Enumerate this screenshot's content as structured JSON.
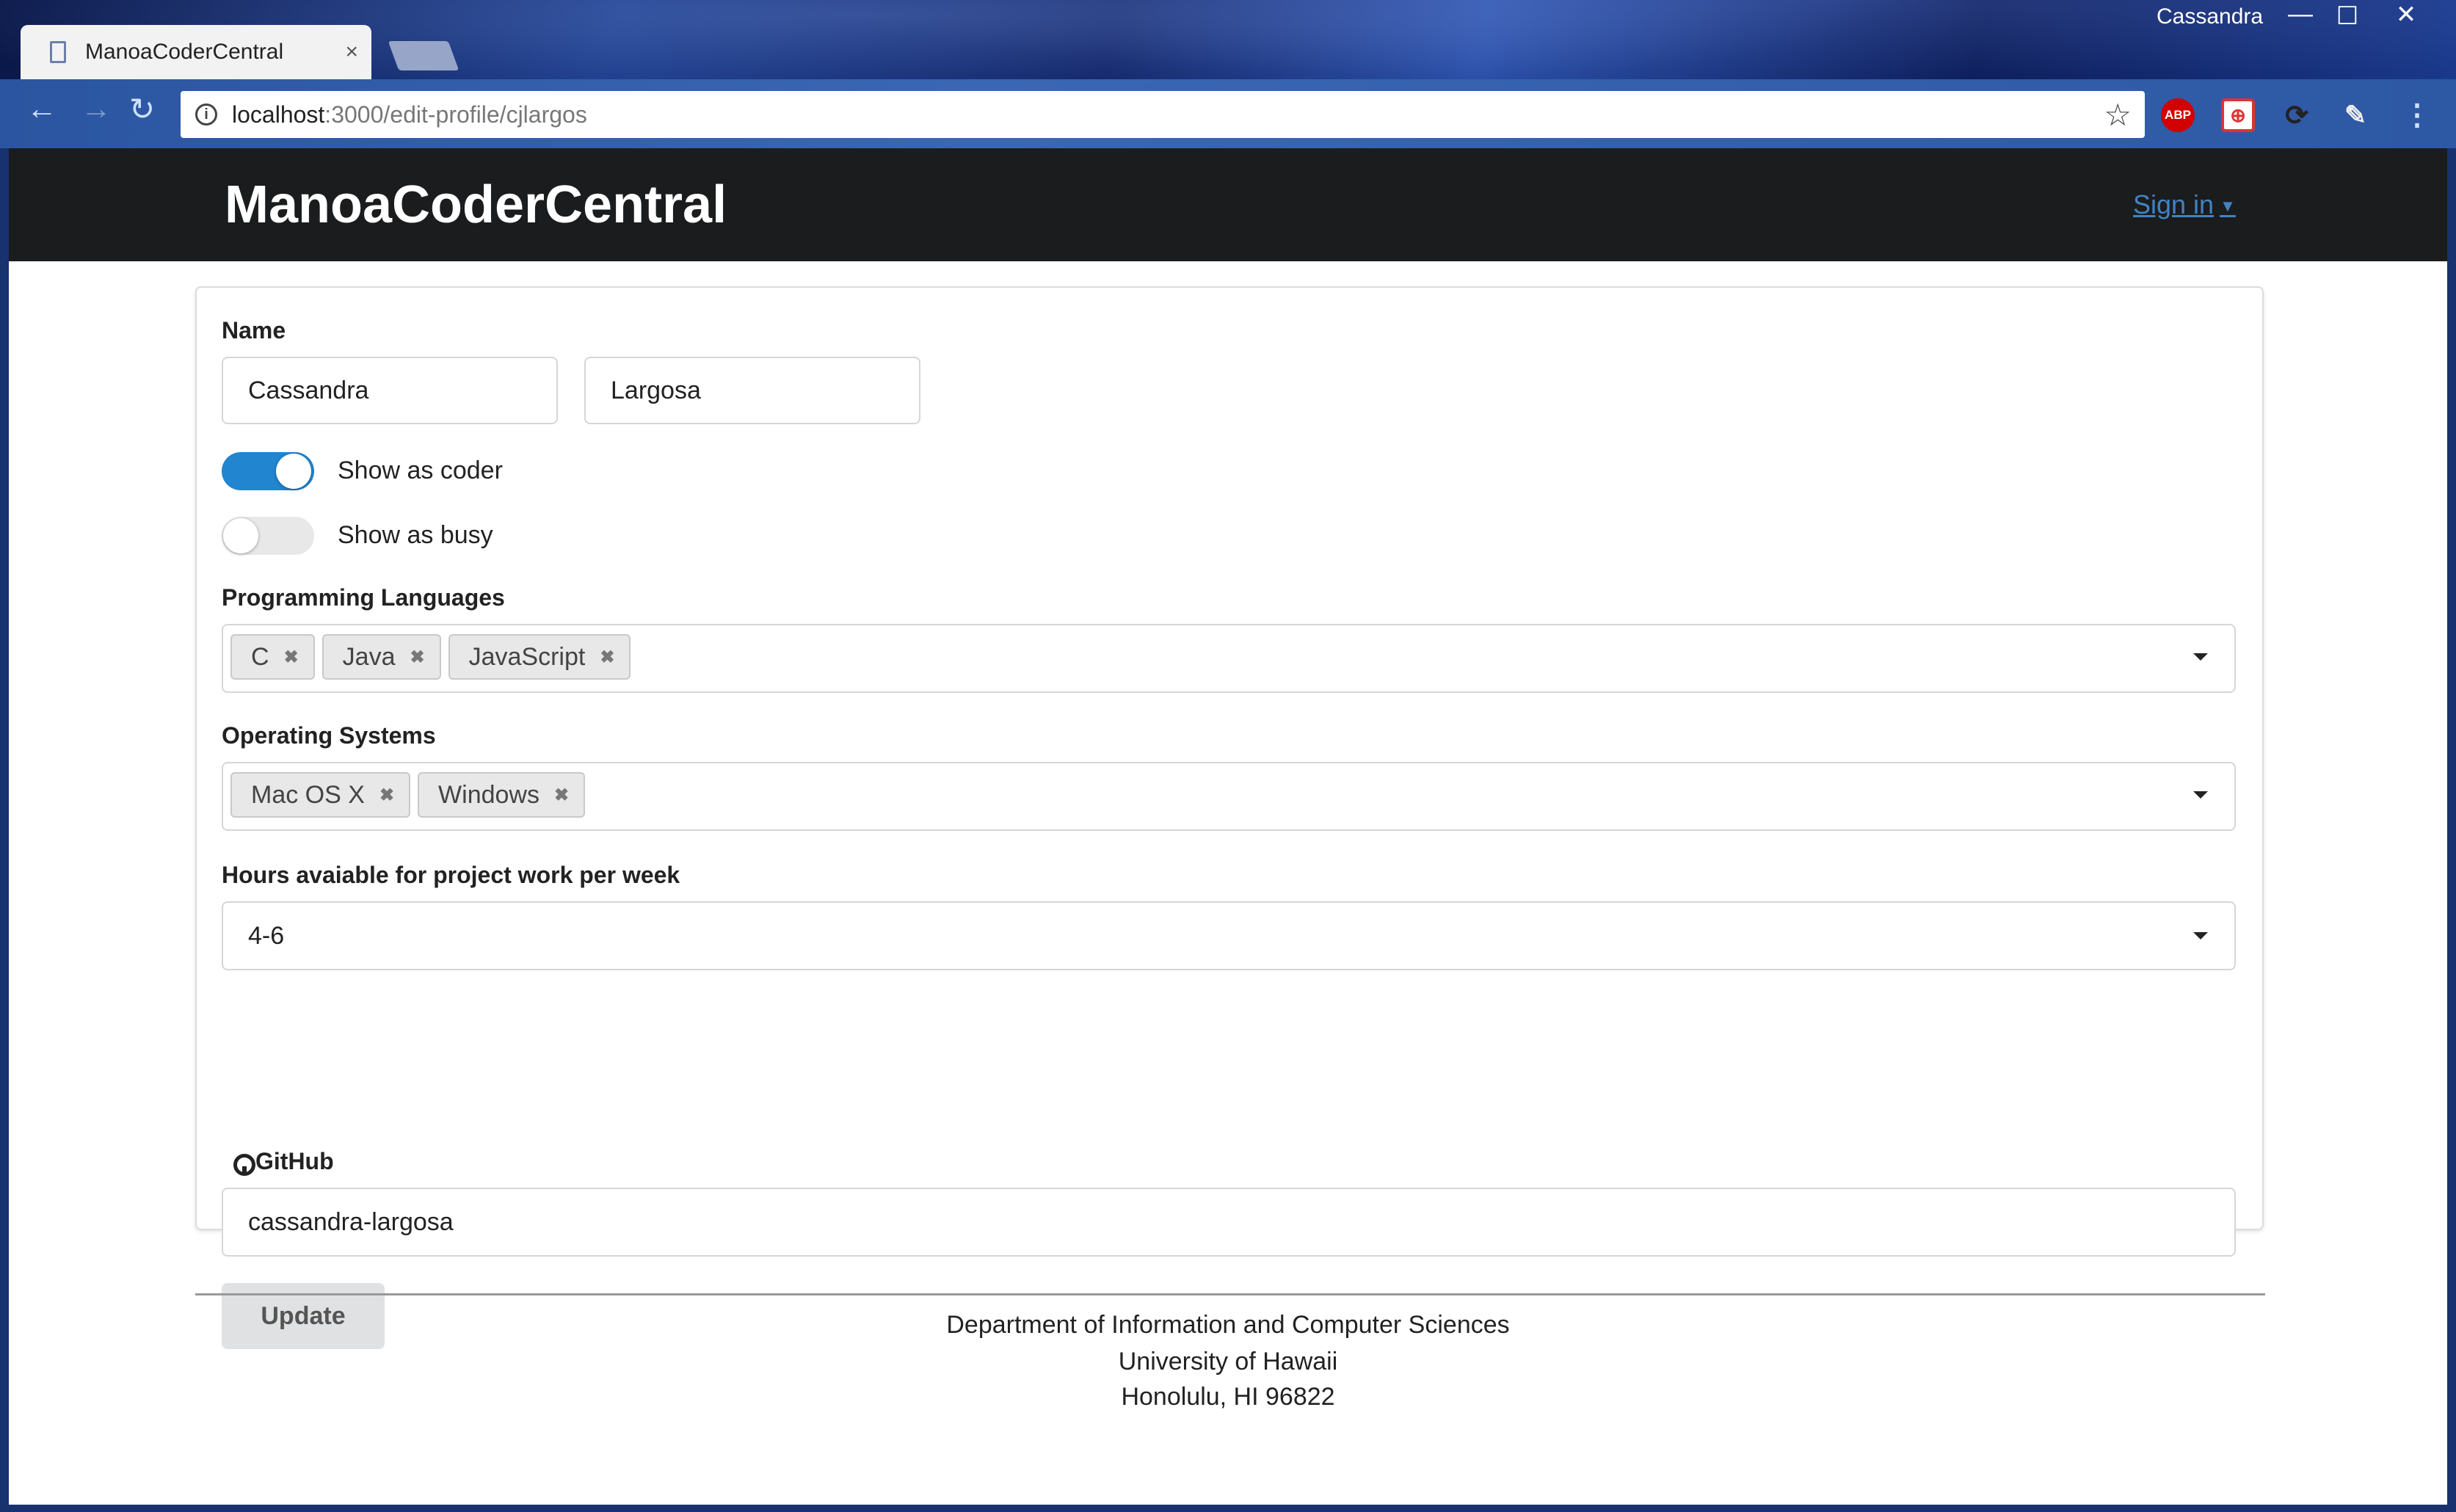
{
  "window": {
    "user": "Cassandra",
    "minimize": "—",
    "maximize": "☐",
    "close": "✕"
  },
  "tab": {
    "title": "ManoaCoderCentral",
    "close": "×"
  },
  "toolbar": {
    "back": "←",
    "forward": "→",
    "reload": "↻",
    "info": "i",
    "host": "localhost",
    "path": ":3000/edit-profile/cjlargos",
    "star": "☆",
    "extensions": {
      "abp": "ABP",
      "globe": "⊕",
      "sync": "⟳",
      "pen": "✎",
      "menu": "⋮"
    }
  },
  "navbar": {
    "brand": "ManoaCoderCentral",
    "signin": "Sign in",
    "caret": "▼"
  },
  "form": {
    "name_label": "Name",
    "first_name": "Cassandra",
    "last_name": "Largosa",
    "show_as_coder": {
      "label": "Show as coder",
      "checked": true
    },
    "show_as_busy": {
      "label": "Show as busy",
      "checked": false
    },
    "languages_label": "Programming Languages",
    "languages": [
      "C",
      "Java",
      "JavaScript"
    ],
    "os_label": "Operating Systems",
    "operating_systems": [
      "Mac OS X",
      "Windows"
    ],
    "hours_label": "Hours avaiable for project work per week",
    "hours_value": "4-6",
    "github_label": "GitHub",
    "github_value": "cassandra-largosa",
    "update_button": "Update",
    "chip_remove": "✖"
  },
  "footer": {
    "line1": "Department of Information and Computer Sciences",
    "line2": "University of Hawaii",
    "line3": "Honolulu, HI 96822"
  },
  "colors": {
    "toggle_on": "#2185d0",
    "navbar": "#1b1c1d",
    "link": "#4183c4"
  }
}
